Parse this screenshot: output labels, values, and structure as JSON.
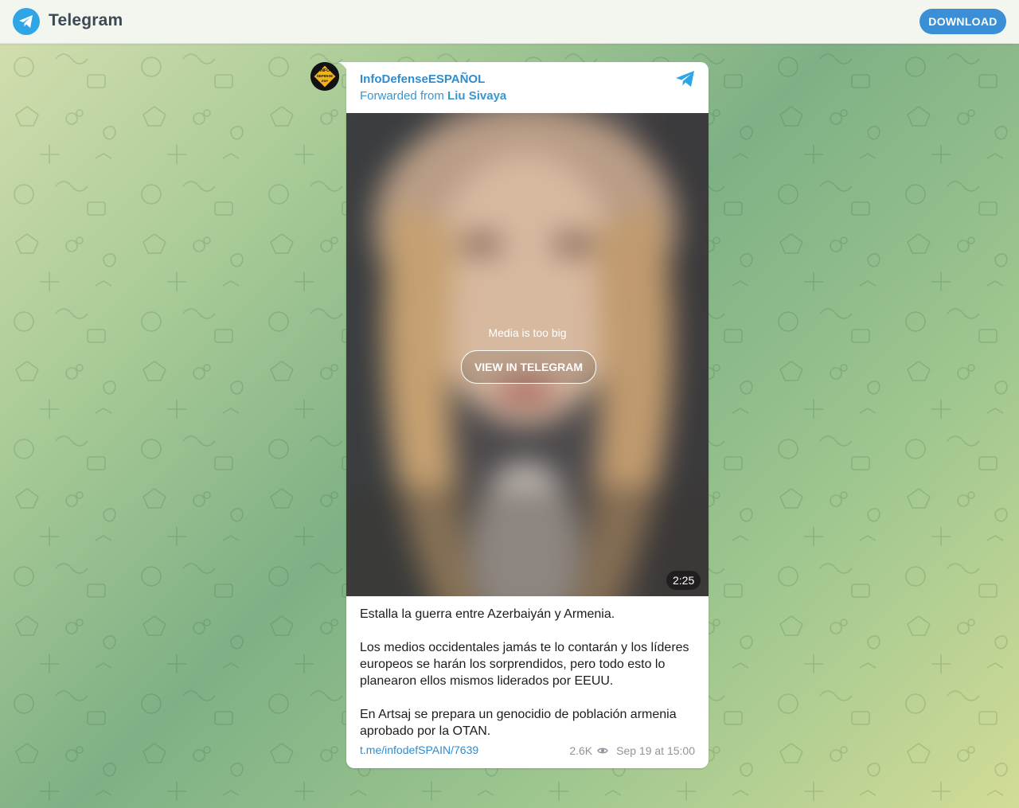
{
  "header": {
    "brand": "Telegram",
    "download_label": "DOWNLOAD",
    "logo_icon": "telegram-logo-icon"
  },
  "post": {
    "channel_name": "InfoDefenseESPAÑOL",
    "forwarded_prefix": "Forwarded from",
    "forwarded_from": "Liu Sivaya",
    "avatar_text": [
      "INFO",
      "DEFENSE",
      "ESP"
    ],
    "media": {
      "message": "Media is too big",
      "button_label": "VIEW IN TELEGRAM",
      "duration": "2:25"
    },
    "text": "Estalla la guerra entre Azerbaiyán y Armenia.\n\nLos medios occidentales jamás te lo contarán y los líderes europeos se harán los sorprendidos, pero todo esto lo planearon ellos mismos liderados por EEUU.\n\nEn Artsaj se prepara un genocidio de población armenia aprobado por la OTAN.",
    "link": "t.me/infodefSPAIN/7639",
    "views": "2.6K",
    "date": "Sep 19 at 15:00"
  },
  "colors": {
    "accent": "#3a8fd6",
    "link": "#2f8ccf",
    "telegram_blue": "#2ea6e6"
  }
}
